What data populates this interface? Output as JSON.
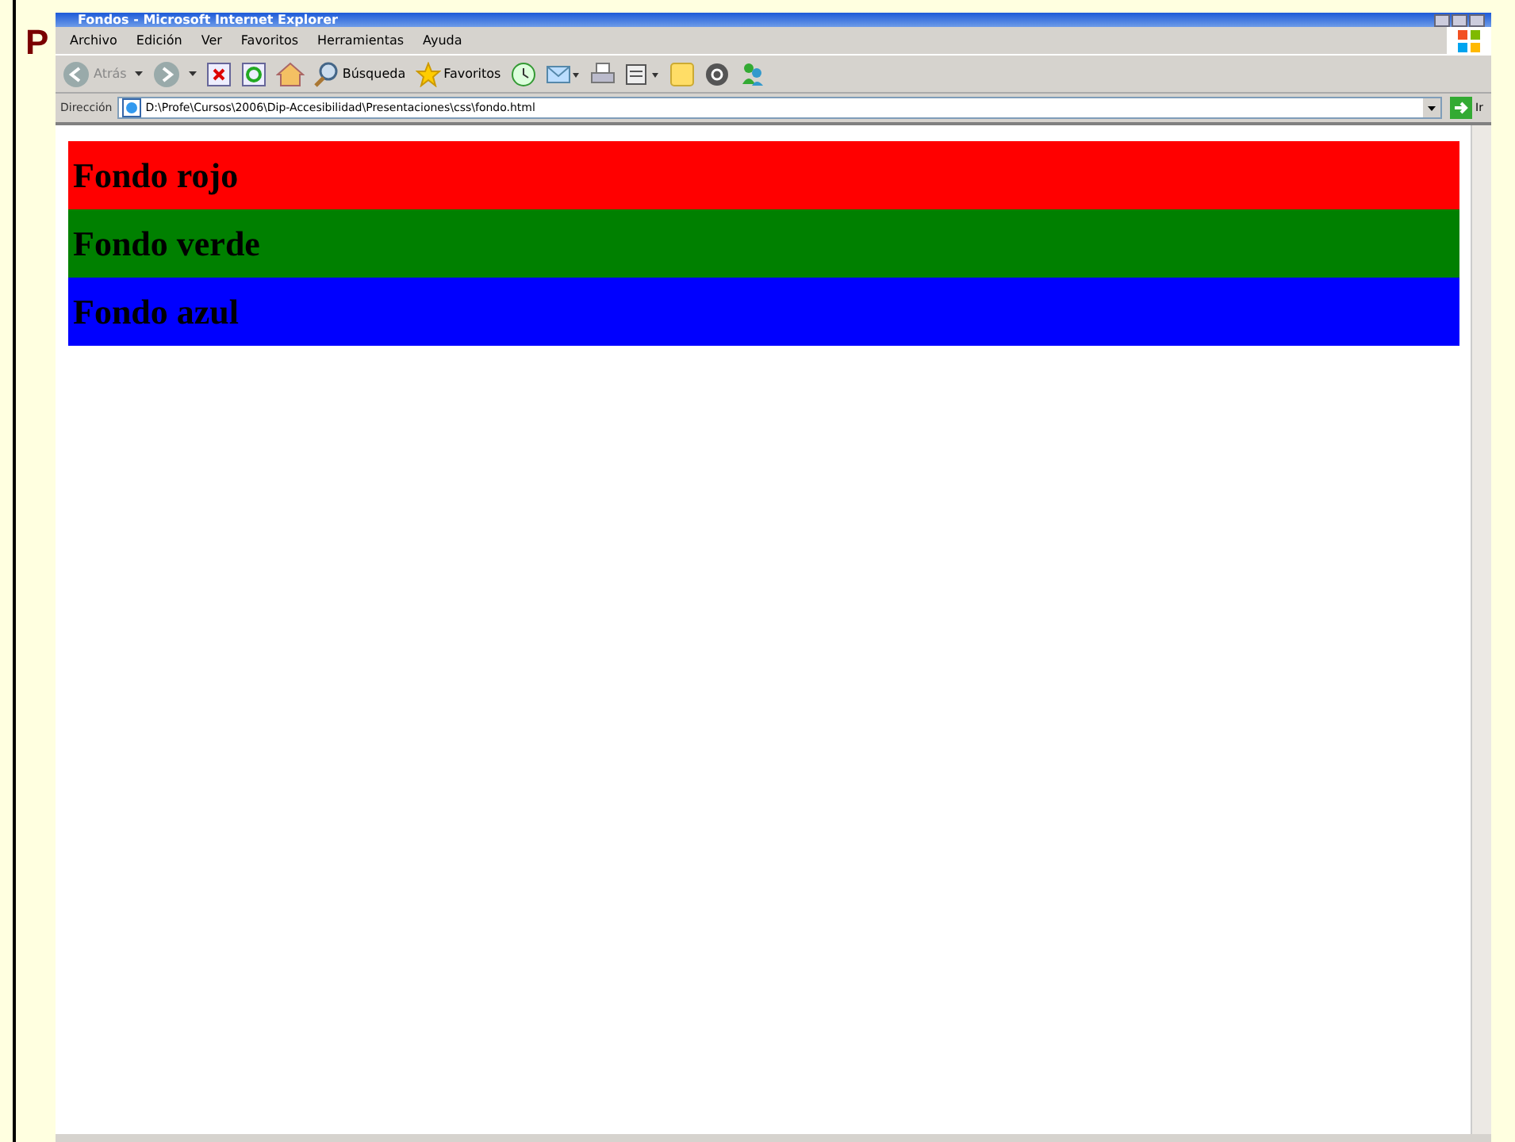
{
  "slide": {
    "title": "P"
  },
  "window": {
    "title": "Fondos - Microsoft Internet Explorer"
  },
  "menu": [
    "Archivo",
    "Edición",
    "Ver",
    "Favoritos",
    "Herramientas",
    "Ayuda"
  ],
  "toolbar": [
    {
      "kind": "back",
      "label": "Atrás"
    },
    {
      "kind": "forward"
    },
    {
      "kind": "stop"
    },
    {
      "kind": "refresh"
    },
    {
      "kind": "home"
    },
    {
      "kind": "search",
      "label": "Búsqueda"
    },
    {
      "kind": "favorites",
      "label": "Favoritos"
    },
    {
      "kind": "history"
    },
    {
      "kind": "mail"
    },
    {
      "kind": "print"
    },
    {
      "kind": "edit"
    },
    {
      "kind": "note"
    },
    {
      "kind": "research"
    },
    {
      "kind": "messenger"
    }
  ],
  "address_bar": {
    "label": "Dirección",
    "value": "D:\\Profe\\Cursos\\2006\\Dip-Accesibilidad\\Presentaciones\\css\\fondo.html",
    "go": "Ir"
  },
  "page": {
    "blocks": [
      {
        "text": "Fondo rojo",
        "color": "#ff0000"
      },
      {
        "text": "Fondo verde",
        "color": "#008000"
      },
      {
        "text": "Fondo azul",
        "color": "#0000ff"
      }
    ]
  }
}
